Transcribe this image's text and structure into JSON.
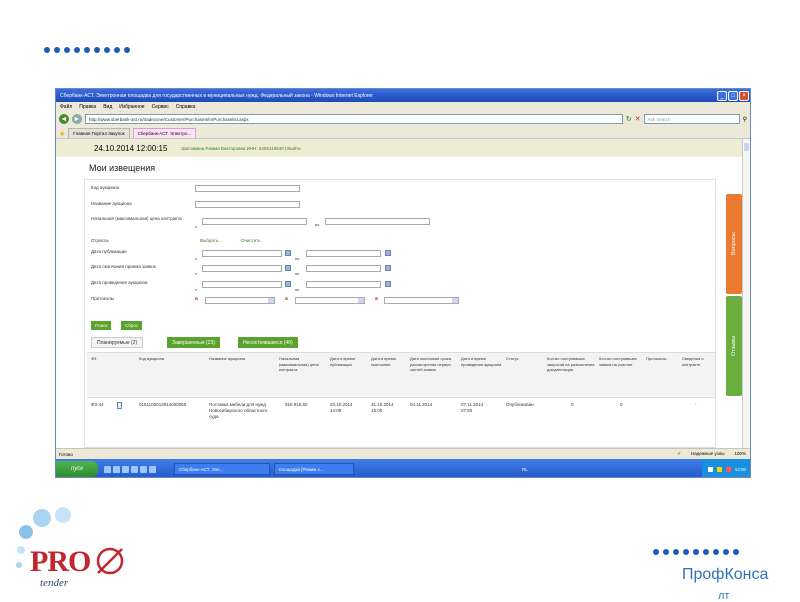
{
  "browser": {
    "title": "Сбербанк-АСТ. Электронная площадка для государственных и муниципальных нужд. Федеральный закона - Windows Internet Explorer",
    "menu": [
      "Файл",
      "Правка",
      "Вид",
      "Избранное",
      "Сервис",
      "Справка"
    ],
    "address": "http://www.sberbank-ast.ru/tradezone/Customer/PurchaseInfo/Purchaselist.aspx",
    "search_placeholder": "Ask Search",
    "tabs": [
      "Главная Портал Закупок",
      "Сбербанк-АСТ. Электро..."
    ],
    "status_left": "Готово",
    "status_zone": "Надежные узлы",
    "status_zoom": "100%"
  },
  "site": {
    "datetime": "24.10.2014 12:00:15",
    "user": "Шатовкина Римма Викторовна ИНН: 5406118840 | Выйти"
  },
  "page": {
    "title": "Мои извещения",
    "fields": {
      "code": "Код аукциона",
      "name": "Название аукциона",
      "price": "Начальная (максимальная) цена контракта",
      "industry": "Отрасль",
      "publish": "Дата публикации",
      "deadline": "Дата окончания приема заявок",
      "auction_date": "Дата проведения аукциона",
      "protocols": "Протоколы"
    },
    "from_label": "с",
    "to_label": "по",
    "select_link": "Выбрать...",
    "clear_link": "Очистить",
    "search_button": "Поиск",
    "reset_button": "Сброс",
    "tabs": [
      "Планируемые (2)",
      "Завершенные (23)",
      "Несостоявшиеся (40)"
    ],
    "columns": [
      "ФЗ",
      "Код аукциона",
      "Название аукциона",
      "Начальная (максимальная) цена контракта",
      "Дата и время публикации",
      "Дата и время окончания",
      "Дата окончания срока рассмотрения первых частей заявок",
      "Дата и время проведения аукциона",
      "Статус",
      "Кол-во поступивших запросов на разъяснение документации",
      "Кол-во поступивших заявок на участие",
      "Протоколы",
      "Сведения о контракте"
    ],
    "row": {
      "fz": "ФЗ-44",
      "code": "0151100014914000055",
      "name": "Поставка мебели для нужд Новосибирского областного суда",
      "price": "516 916.50",
      "published": "23.10.2014 14:09",
      "ends": "31.10.2014 15:00",
      "review": "04.11.2014",
      "auction": "07.11.2014 07:50",
      "status": "Опубликован",
      "requests": "0",
      "applications": "0",
      "contract": "-"
    },
    "side_tabs": [
      "Вопросы",
      "Отзывы"
    ]
  },
  "taskbar": {
    "start": "пуск",
    "items": [
      "Сбербанк-АСТ. Эле...",
      "площадка [Режим с..."
    ],
    "tray_lang": "RL",
    "time": "13:00"
  },
  "slide": {
    "logo_text": "PRO",
    "logo_sub": "tender",
    "brand_line1": "ПрофКонса",
    "brand_line2": "лт"
  },
  "colors": {
    "accent_blue": "#1e5bb5",
    "green": "#5aa32e",
    "orange": "#e97a2f",
    "logo_red": "#c0282e"
  }
}
